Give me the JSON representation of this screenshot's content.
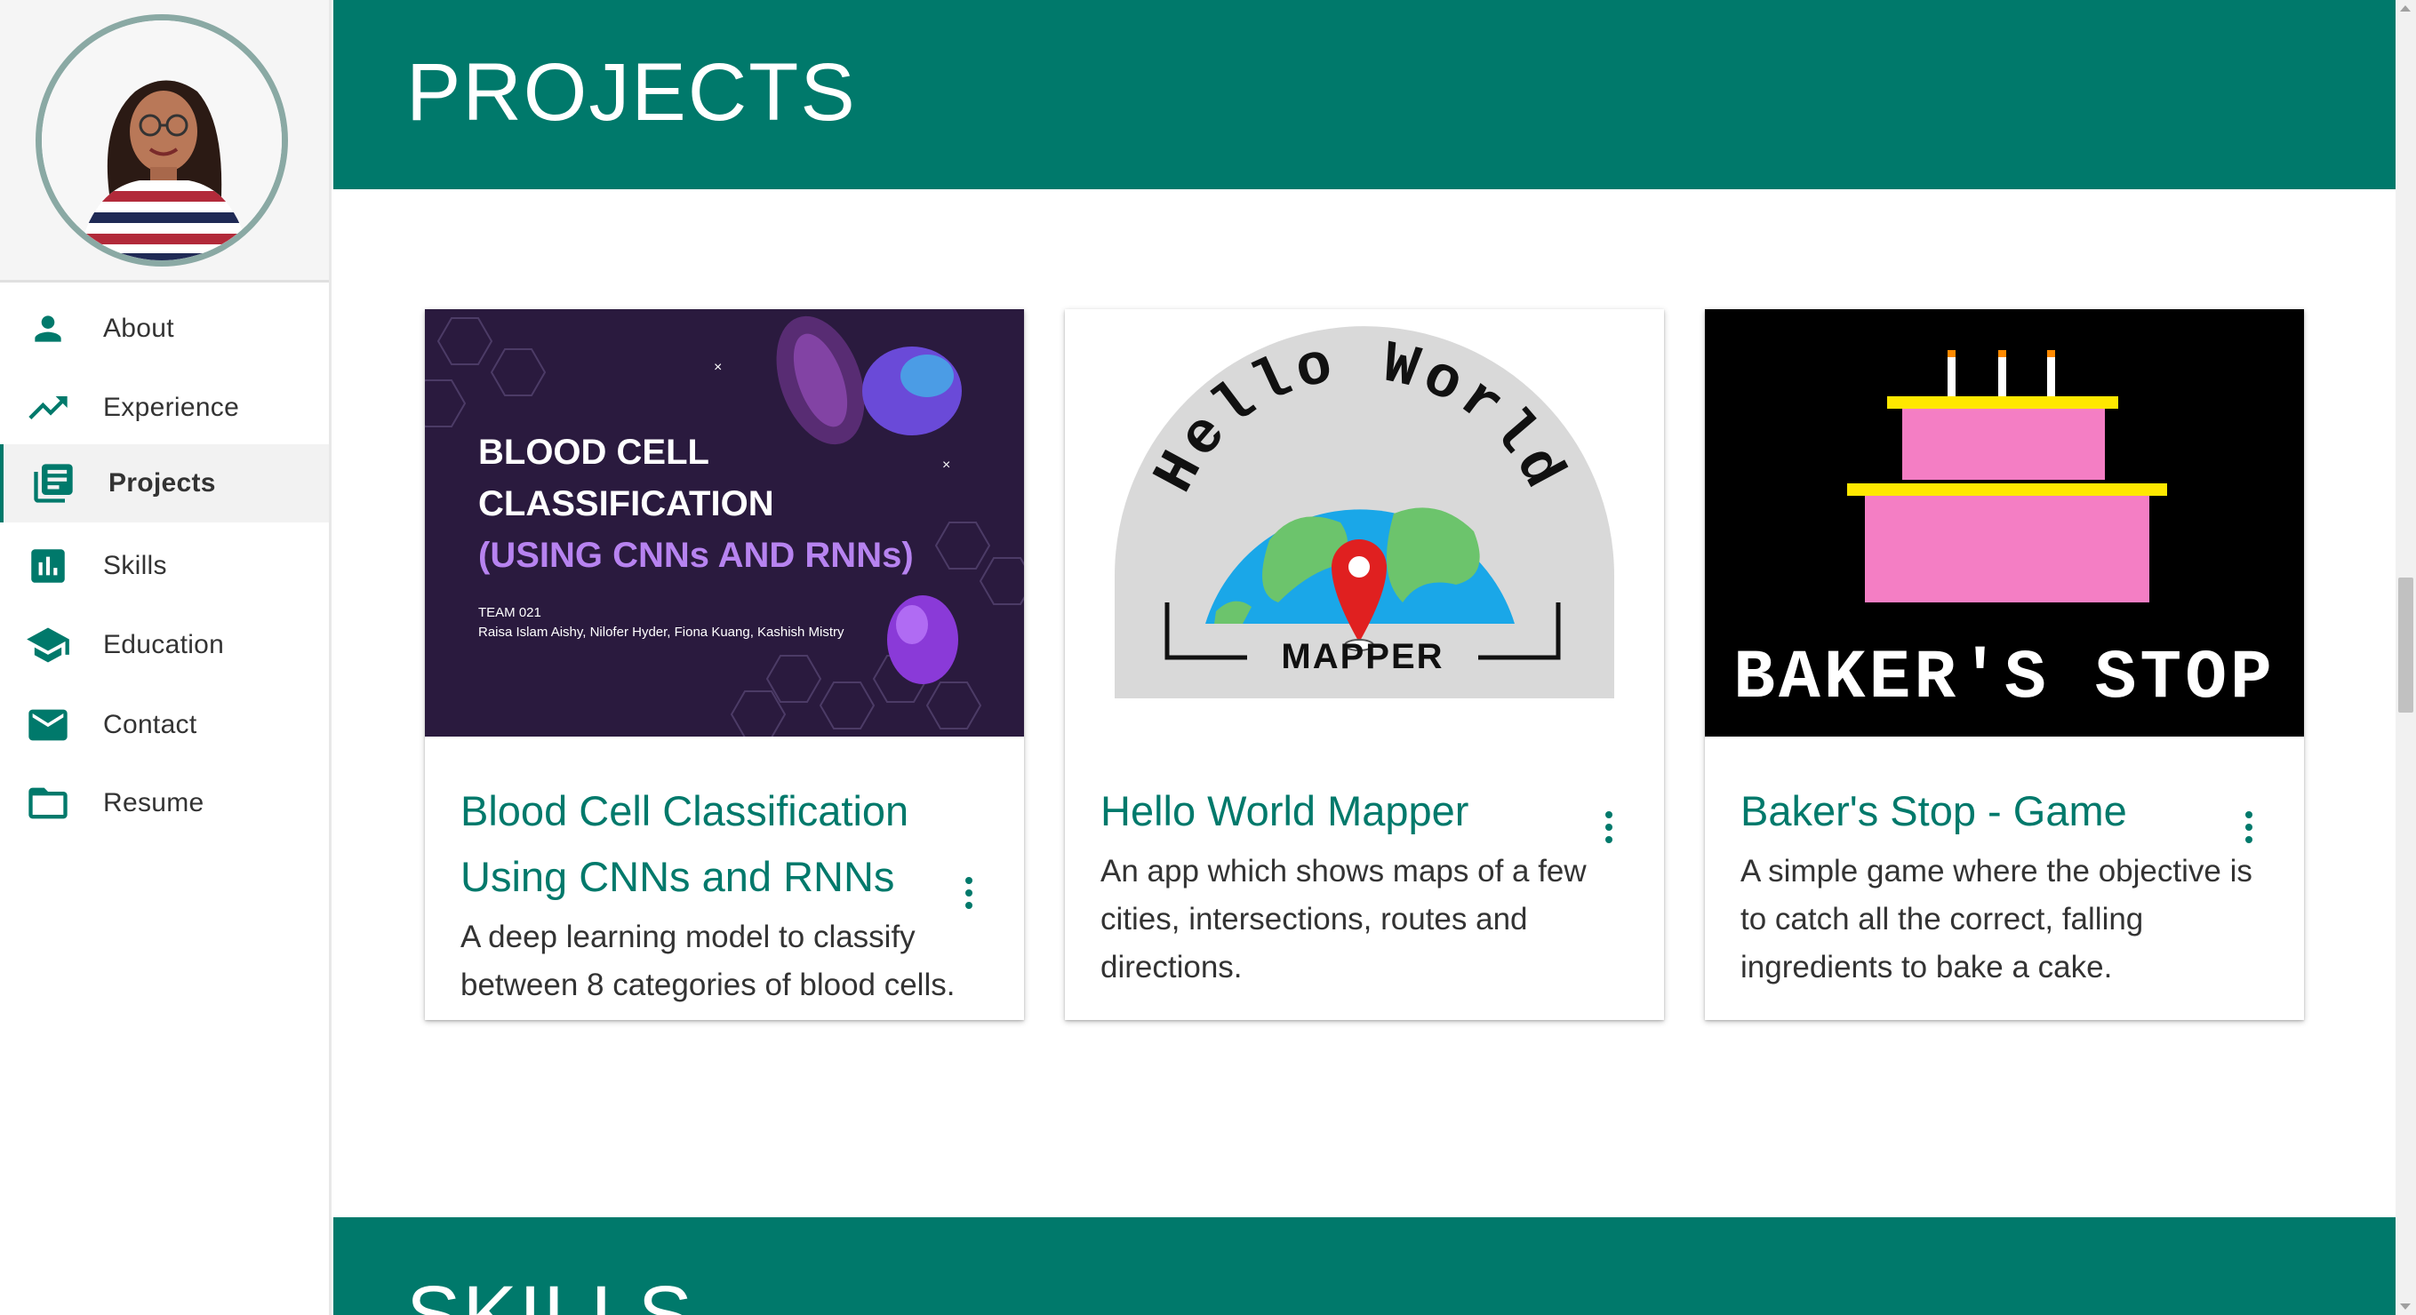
{
  "sidebar": {
    "items": [
      {
        "label": "About",
        "icon": "person-icon"
      },
      {
        "label": "Experience",
        "icon": "trending-up-icon"
      },
      {
        "label": "Projects",
        "icon": "library-books-icon",
        "active": true
      },
      {
        "label": "Skills",
        "icon": "bar-chart-icon"
      },
      {
        "label": "Education",
        "icon": "school-icon"
      },
      {
        "label": "Contact",
        "icon": "mail-icon"
      },
      {
        "label": "Resume",
        "icon": "folder-icon"
      }
    ]
  },
  "header": {
    "title": "PROJECTS"
  },
  "projects": [
    {
      "title": "Blood Cell Classification Using CNNs and RNNs",
      "description": "A deep learning model to classify between 8 categories of blood cells.",
      "image": {
        "line1": "BLOOD CELL",
        "line2": "CLASSIFICATION",
        "line3": "(USING CNNs AND RNNs)",
        "team": "TEAM 021",
        "members": "Raisa Islam Aishy, Nilofer Hyder, Fiona Kuang, Kashish Mistry"
      }
    },
    {
      "title": "Hello World Mapper",
      "description": "An app which shows maps of a few cities, intersections, routes and directions.",
      "image": {
        "arc_text": "Hello World",
        "caption": "MAPPER"
      }
    },
    {
      "title": "Baker's Stop - Game",
      "description": "A simple game where the objective is to catch all the correct, falling ingredients to bake a cake.",
      "image": {
        "caption": "BAKER'S STOP"
      }
    }
  ],
  "next_section": {
    "title": "SKILLS"
  },
  "colors": {
    "accent": "#00796b",
    "nav_icon": "#00796b",
    "card_title": "#00796b"
  }
}
